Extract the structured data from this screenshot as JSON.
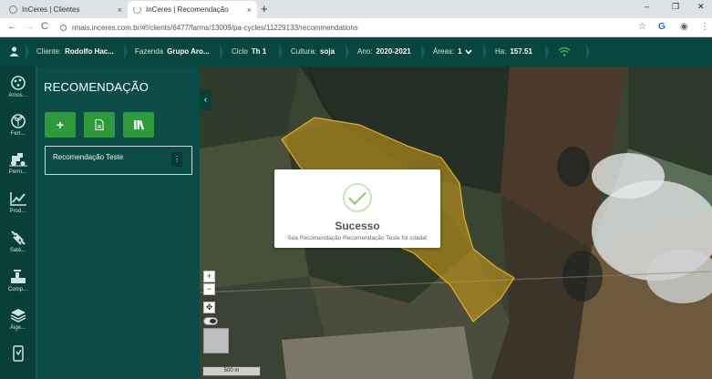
{
  "browser": {
    "tabs": [
      {
        "title": "InCeres | Clientes",
        "close": "×"
      },
      {
        "title": "InCeres | Recomendação",
        "close": "×"
      }
    ],
    "new_tab": "+",
    "window_controls": {
      "minimize": "–",
      "maximize": "❐",
      "close": "✕"
    },
    "nav": {
      "back": "←",
      "forward": "→",
      "reload": "C"
    },
    "url": "rmais.inceres.com.br/#!/clients/6477/farms/13009/pa-cycles/11229133/recommendations",
    "actions": {
      "star": "☆",
      "extension": "G",
      "account": "◉",
      "menu": "⋮"
    }
  },
  "appbar": {
    "cliente": {
      "label": "Cliente:",
      "value": "Rodolfo Hac..."
    },
    "fazenda": {
      "label": "Fazenda",
      "value": "Grupo Aro..."
    },
    "ciclo": {
      "label": "Ciclo",
      "value": "Th 1"
    },
    "cultura": {
      "label": "Cultura:",
      "value": "soja"
    },
    "ano": {
      "label": "Ano:",
      "value": "2020-2021"
    },
    "areas": {
      "label": "Áreas:",
      "value": "1"
    },
    "ha": {
      "label": "Ha:",
      "value": "157.51"
    },
    "user_icon": "user-icon",
    "wifi_icon": "wifi-icon"
  },
  "rail": [
    {
      "label": "Amos...",
      "icon": "sampling-icon"
    },
    {
      "label": "Fert...",
      "icon": "fertility-icon"
    },
    {
      "label": "Perm...",
      "icon": "tractor-icon"
    },
    {
      "label": "Prod...",
      "icon": "chart-line-icon"
    },
    {
      "label": "Saté...",
      "icon": "satellite-icon"
    },
    {
      "label": "Comp...",
      "icon": "compaction-icon"
    },
    {
      "label": "Álge...",
      "icon": "layers-icon"
    },
    {
      "label": "",
      "icon": "device-icon"
    }
  ],
  "panel": {
    "title": "RECOMENDAÇÃO",
    "buttons": {
      "add": "+",
      "pdf": "pdf-icon",
      "books": "library-icon"
    },
    "recommendation": {
      "name": "Recomendação Teste",
      "menu": "⋮"
    }
  },
  "map": {
    "collapse": "‹",
    "zoom_in": "+",
    "zoom_out": "−",
    "move": "✥",
    "scale": "500 m"
  },
  "modal": {
    "title": "Sucesso",
    "message": "Sua Recomendação Recomendação Teste foi criada!"
  },
  "colors": {
    "appbar": "#07463f",
    "panel": "#0b4d46",
    "button": "#2e9a3b",
    "field": "#d4a017",
    "success": "#8cc96b"
  }
}
